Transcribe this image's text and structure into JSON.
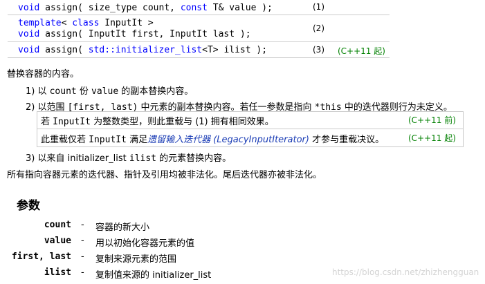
{
  "overloads": [
    {
      "lines": [
        [
          {
            "text": "void",
            "kw": true
          },
          {
            "text": " assign( size_type count, ",
            "kw": false
          },
          {
            "text": "const",
            "kw": true
          },
          {
            "text": " T& value );",
            "kw": false
          }
        ]
      ],
      "number": "(1)",
      "since": ""
    },
    {
      "lines": [
        [
          {
            "text": "template",
            "kw": true
          },
          {
            "text": "< ",
            "kw": false
          },
          {
            "text": "class",
            "kw": true
          },
          {
            "text": " InputIt >",
            "kw": false
          }
        ],
        [
          {
            "text": "void",
            "kw": true
          },
          {
            "text": " assign( InputIt first, InputIt last );",
            "kw": false
          }
        ]
      ],
      "number": "(2)",
      "since": ""
    },
    {
      "lines": [
        [
          {
            "text": "void",
            "kw": true
          },
          {
            "text": " assign( ",
            "kw": false
          },
          {
            "text": "std::initializer_list",
            "kw": true
          },
          {
            "text": "<T> ilist );",
            "kw": false
          }
        ]
      ],
      "number": "(3)",
      "since": "(C++11 起)"
    }
  ],
  "intro": "替换容器的内容。",
  "items": {
    "i1": {
      "prefix": "1) 以 ",
      "code1": "count",
      "mid": " 份 ",
      "code2": "value",
      "suffix": " 的副本替换内容。"
    },
    "i2": {
      "prefix": "2) 以范围 ",
      "code": "[first, last)",
      "suffix": " 中元素的副本替换内容。若任一参数是指向 ",
      "code2": "*this",
      "suffix2": " 中的迭代器则行为未定义。"
    },
    "i3": {
      "prefix": "3) 以来自 initializer_list ",
      "code": "ilist",
      "suffix": " 的元素替换内容。"
    }
  },
  "notes": {
    "n1": {
      "prefix": "若 ",
      "code": "InputIt",
      "suffix": " 为整数类型，则此重载与 (1) 拥有相同效果。",
      "since": "(C++11 前)"
    },
    "n2": {
      "prefix": "此重载仅若 ",
      "code": "InputIt",
      "mid": " 满足",
      "link": "遗留输入迭代器 (LegacyInputIterator)",
      "suffix": " 才参与重载决议。",
      "since": "(C++11 起)"
    }
  },
  "invalidation": "所有指向容器元素的迭代器、指针及引用均被非法化。尾后迭代器亦被非法化。",
  "params_heading": "参数",
  "params": [
    {
      "name": "count",
      "dash": "-",
      "desc": "容器的新大小"
    },
    {
      "name": "value",
      "dash": "-",
      "desc": "用以初始化容器元素的值"
    },
    {
      "name": "first, last",
      "dash": "-",
      "desc": "复制来源元素的范围"
    },
    {
      "name": "ilist",
      "dash": "-",
      "desc": "复制值来源的 initializer_list"
    }
  ],
  "watermark": "https://blog.csdn.net/zhizhengguan",
  "colors": {
    "keyword": "#0000ff",
    "since": "#008000",
    "link": "#1a3cb5",
    "rule": "#cccccc"
  }
}
